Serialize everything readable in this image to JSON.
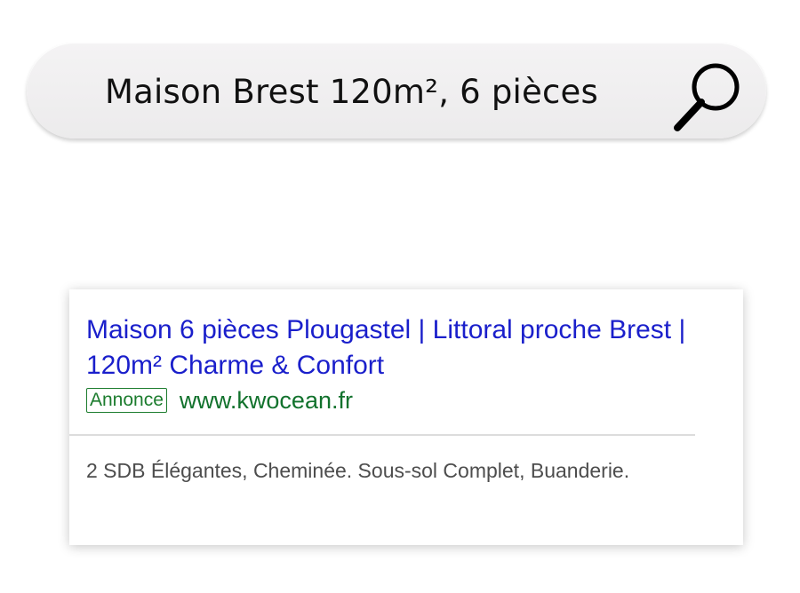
{
  "search": {
    "query": "Maison Brest 120m², 6 pièces",
    "icon": "search-icon"
  },
  "ad": {
    "title": "Maison 6 pièces Plougastel | Littoral proche Brest | 120m² Charme & Confort",
    "badge": "Annonce",
    "url": "www.kwocean.fr",
    "description": "2 SDB Élégantes, Cheminée. Sous-sol Complet, Buanderie."
  },
  "colors": {
    "title_link": "#1a1fcb",
    "url_green": "#12722d",
    "description_gray": "#4d4d4d",
    "search_bar_bg": "#f0eff0"
  }
}
